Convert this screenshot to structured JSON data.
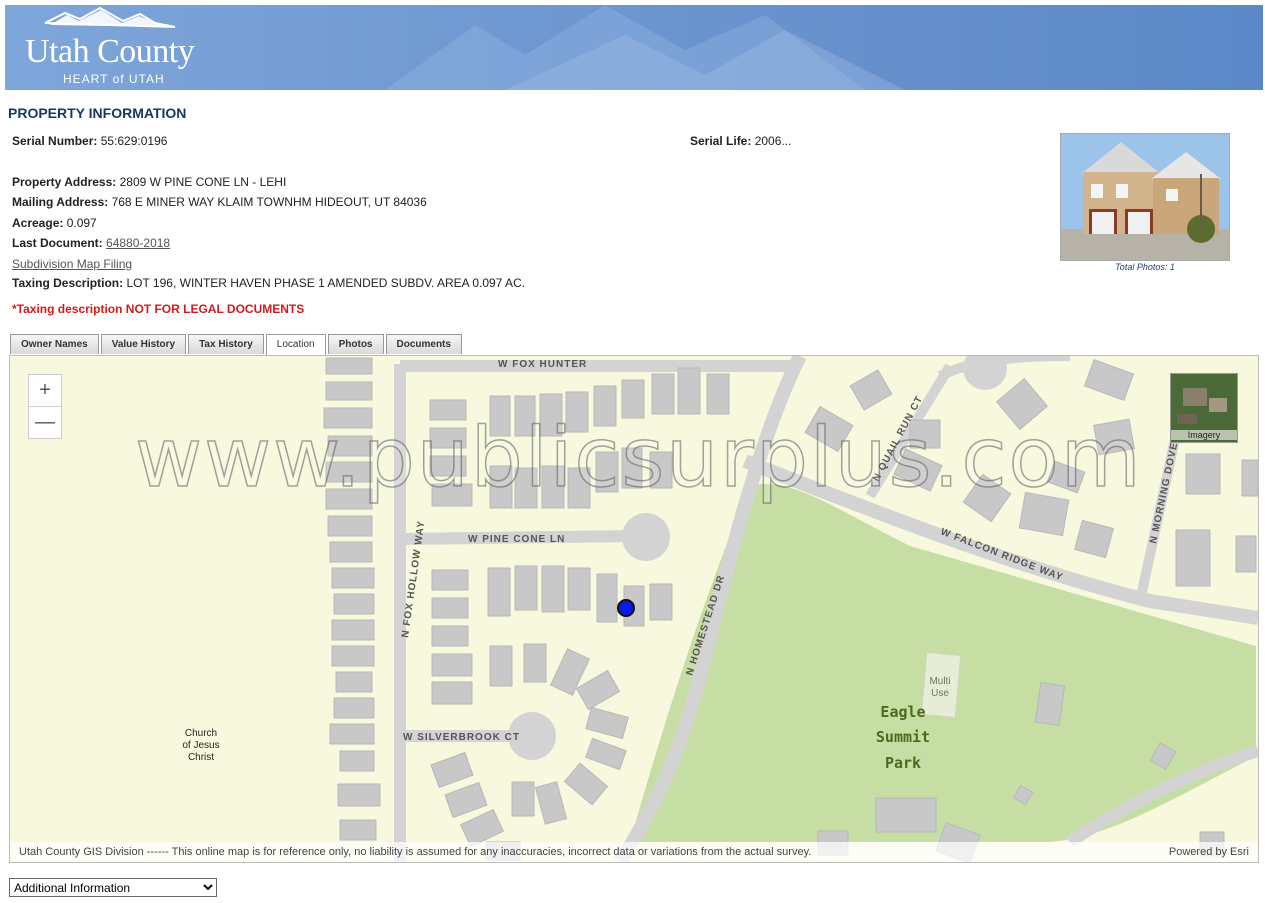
{
  "header": {
    "logo_title": "Utah County",
    "logo_subtitle": "HEART of UTAH"
  },
  "page_title": "PROPERTY INFORMATION",
  "property": {
    "serial_number_label": "Serial Number:",
    "serial_number": "55:629:0196",
    "serial_life_label": "Serial Life:",
    "serial_life": "2006...",
    "address_label": "Property Address:",
    "address": "2809 W PINE CONE LN - LEHI",
    "mailing_label": "Mailing Address:",
    "mailing": "768 E MINER WAY KLAIM TOWNHM HIDEOUT, UT 84036",
    "acreage_label": "Acreage:",
    "acreage": "0.097",
    "last_doc_label": "Last Document:",
    "last_doc": "64880-2018",
    "subdivision_link": "Subdivision Map Filing",
    "taxing_label": "Taxing Description:",
    "taxing": "LOT 196, WINTER HAVEN PHASE 1 AMENDED SUBDV. AREA 0.097 AC.",
    "warning": "*Taxing description NOT FOR LEGAL DOCUMENTS"
  },
  "photo": {
    "caption": "Total Photos: 1"
  },
  "tabs": [
    {
      "label": "Owner Names",
      "active": false
    },
    {
      "label": "Value History",
      "active": false
    },
    {
      "label": "Tax History",
      "active": false
    },
    {
      "label": "Location",
      "active": true
    },
    {
      "label": "Photos",
      "active": false
    },
    {
      "label": "Documents",
      "active": false
    }
  ],
  "map": {
    "zoom_in": "+",
    "zoom_out": "—",
    "imagery_label": "Imagery",
    "watermark": "www.publicsurplus.com",
    "streets": {
      "fox_hunter": "W FOX HUNTER",
      "pine_cone": "W PINE CONE LN",
      "fox_hollow": "N FOX HOLLOW WAY",
      "silverbrook": "W SILVERBROOK CT",
      "homestead": "N HOMESTEAD DR",
      "quail_run": "N QUAIL RUN CT",
      "falcon_ridge": "W FALCON RIDGE WAY",
      "morning_dove": "N MORNING DOVE CIR"
    },
    "places": {
      "church_1": "Church",
      "church_2": "of Jesus",
      "church_3": "Christ",
      "multi_1": "Multi",
      "multi_2": "Use",
      "park_1": "Eagle",
      "park_2": "Summit",
      "park_3": "Park"
    },
    "attribution": "Utah County GIS Division ------ This online map is for reference only, no liability is assumed for any inaccuracies, incorrect data or variations from the actual survey.",
    "powered_by": "Powered by Esri"
  },
  "dropdown": {
    "selected": "Additional Information"
  },
  "colors": {
    "title_blue": "#17375e",
    "warning_red": "#d11b1b",
    "map_bg": "#f7f8de",
    "park_green": "#c6dea4",
    "road_gray": "#d3d3d3",
    "marker_blue": "#0a18e8"
  }
}
